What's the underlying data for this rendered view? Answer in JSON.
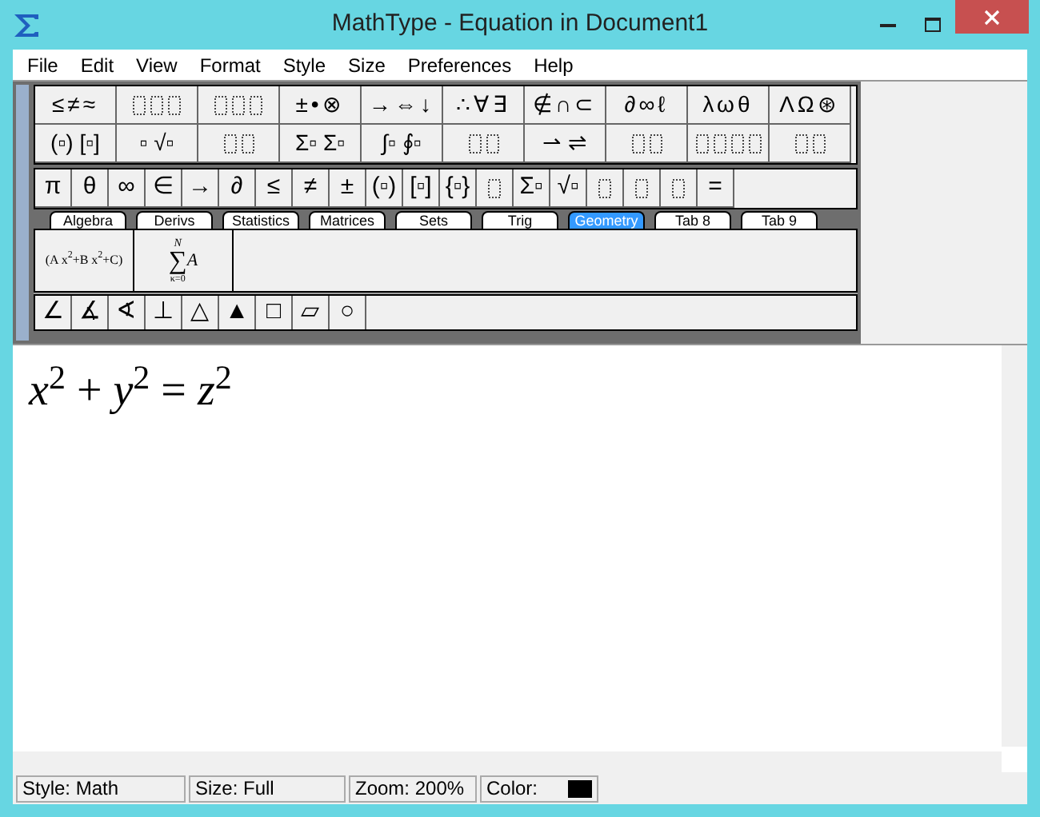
{
  "window": {
    "title": "MathType - Equation in Document1"
  },
  "menu": [
    "File",
    "Edit",
    "View",
    "Format",
    "Style",
    "Size",
    "Preferences",
    "Help"
  ],
  "palette_row_1": [
    {
      "kind": "text",
      "text": "≤≠≈"
    },
    {
      "kind": "triple"
    },
    {
      "kind": "triple"
    },
    {
      "kind": "text",
      "text": "±•⊗"
    },
    {
      "kind": "text",
      "text": "→⇔↓"
    },
    {
      "kind": "text",
      "text": "∴∀∃"
    },
    {
      "kind": "text",
      "text": "∉∩⊂"
    },
    {
      "kind": "text",
      "text": "∂∞ℓ"
    },
    {
      "kind": "text",
      "text": "λωθ"
    },
    {
      "kind": "text",
      "text": "ΛΩ⊛"
    }
  ],
  "palette_row_2": [
    {
      "kind": "text",
      "text": "(▫) [▫]"
    },
    {
      "kind": "text",
      "text": "▫ √▫"
    },
    {
      "kind": "pair"
    },
    {
      "kind": "text",
      "text": "Σ▫ Σ▫"
    },
    {
      "kind": "text",
      "text": "∫▫ ∮▫"
    },
    {
      "kind": "pair"
    },
    {
      "kind": "text",
      "text": "⇀ ⇌"
    },
    {
      "kind": "pair"
    },
    {
      "kind": "quad"
    },
    {
      "kind": "pair"
    }
  ],
  "small_row": [
    {
      "kind": "text",
      "text": "π"
    },
    {
      "kind": "text",
      "text": "θ"
    },
    {
      "kind": "text",
      "text": "∞"
    },
    {
      "kind": "text",
      "text": "∈"
    },
    {
      "kind": "text",
      "text": "→"
    },
    {
      "kind": "text",
      "text": "∂"
    },
    {
      "kind": "text",
      "text": "≤"
    },
    {
      "kind": "text",
      "text": "≠"
    },
    {
      "kind": "text",
      "text": "±"
    },
    {
      "kind": "text",
      "text": "(▫)"
    },
    {
      "kind": "text",
      "text": "[▫]"
    },
    {
      "kind": "text",
      "text": "{▫}"
    },
    {
      "kind": "single"
    },
    {
      "kind": "text",
      "text": "Σ▫"
    },
    {
      "kind": "text",
      "text": "√▫"
    },
    {
      "kind": "single"
    },
    {
      "kind": "single"
    },
    {
      "kind": "single"
    },
    {
      "kind": "text",
      "text": "="
    }
  ],
  "tabs": [
    {
      "label": "Algebra",
      "selected": false
    },
    {
      "label": "Derivs",
      "selected": false
    },
    {
      "label": "Statistics",
      "selected": false
    },
    {
      "label": "Matrices",
      "selected": false
    },
    {
      "label": "Sets",
      "selected": false
    },
    {
      "label": "Trig",
      "selected": false
    },
    {
      "label": "Geometry",
      "selected": true
    },
    {
      "label": "Tab 8",
      "selected": false
    },
    {
      "label": "Tab 9",
      "selected": false
    }
  ],
  "expressions": [
    {
      "kind": "polynomial",
      "text": "(A x$^{2}$+B x$^{2}$+C)"
    },
    {
      "kind": "sum",
      "upper": "N",
      "symbol": "∑",
      "lower": "κ=0",
      "body": "A"
    }
  ],
  "geometry_row": [
    "∠",
    "∡",
    "∢",
    "⊥",
    "△",
    "▲",
    "□",
    "▱",
    "○"
  ],
  "equation": "*x*$^{2}$ + *y*$^{2}$ = *z*$^{2}$",
  "status_bar": {
    "style": "Style: Math",
    "size": "Size: Full",
    "zoom": "Zoom: 200%",
    "color_label": "Color:",
    "color": "#000000"
  }
}
